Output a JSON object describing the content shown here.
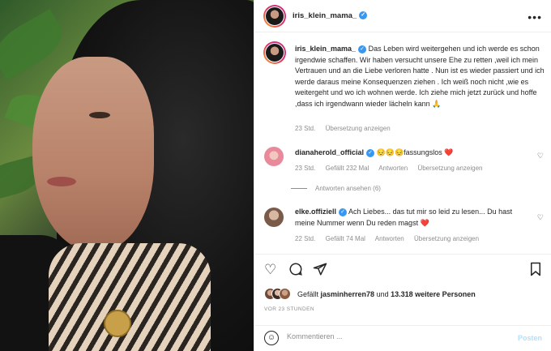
{
  "post": {
    "author": "iris_klein_mama_",
    "caption": "Das Leben wird weitergehen und ich werde es schon irgendwie schaffen. Wir haben versucht unsere Ehe zu retten ,weil ich mein Vertrauen und an die Liebe verloren hatte . Nun ist es wieder passiert und ich werde daraus meine Konsequenzen ziehen . Ich weiß noch nicht ,wie es weitergeht und wo ich wohnen werde. Ich ziehe mich jetzt zurück und hoffe ,dass ich irgendwann wieder lächeln kann",
    "caption_emoji": "🙏",
    "caption_time": "23 Std.",
    "caption_translate": "Übersetzung anzeigen"
  },
  "comments": [
    {
      "user": "dianaherold_official",
      "emojis": "😔😔😔",
      "text": "fassungslos",
      "heart": "❤️",
      "time": "23 Std.",
      "likes": "Gefällt 232 Mal",
      "reply": "Antworten",
      "translate": "Übersetzung anzeigen",
      "view_replies": "Antworten ansehen (6)"
    },
    {
      "user": "elke.offiziell",
      "text": "Ach Liebes... das tut mir so leid zu lesen... Du hast meine Nummer wenn Du reden magst",
      "heart": "❤️",
      "time": "22 Std.",
      "likes": "Gefällt 74 Mal",
      "reply": "Antworten",
      "translate": "Übersetzung anzeigen"
    }
  ],
  "likes": {
    "prefix": "Gefällt",
    "user": "jasminherren78",
    "middle": "und",
    "count": "13.318 weitere Personen"
  },
  "timestamp": "VOR 23 STUNDEN",
  "add_comment": {
    "placeholder": "Kommentieren ...",
    "post_label": "Posten"
  },
  "icons": {
    "more": "more-options-icon",
    "like": "heart-icon",
    "comment": "comment-icon",
    "share": "share-icon",
    "save": "bookmark-icon",
    "emoji": "emoji-icon",
    "verified": "verified-badge-icon"
  },
  "colors": {
    "link_blue": "#3897f0",
    "post_disabled": "#b2dffc",
    "muted": "#8e8e8e"
  }
}
